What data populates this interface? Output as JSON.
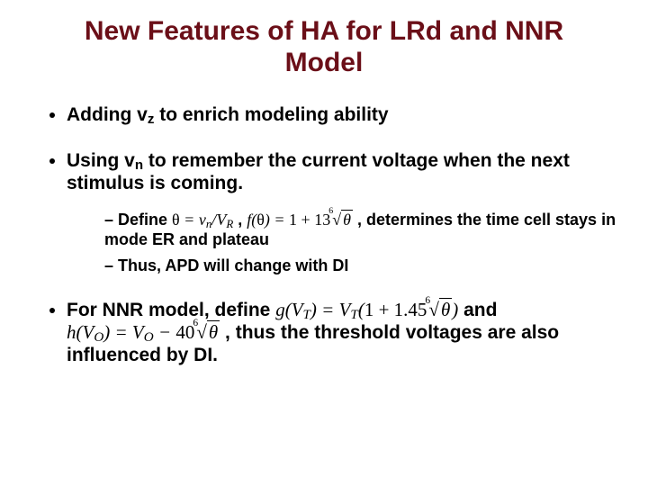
{
  "title": "New Features of HA for LRd and NNR Model",
  "bullets": {
    "b1a": "Adding v",
    "b1sub": "z",
    "b1b": " to enrich modeling ability",
    "b2a": "Using v",
    "b2sub": "n",
    "b2b": " to remember the current voltage when the next stimulus is coming.",
    "b3a": "For NNR model, define ",
    "b3b": " and ",
    "b3c": " , thus the threshold voltages are also influenced by DI."
  },
  "sub": {
    "s1a": "Define ",
    "s1b": " , ",
    "s1c": " , determines the time cell stays in mode ER and plateau",
    "s2": "Thus, APD will change with DI"
  },
  "math": {
    "theta_def": "θ = v_n / V_R",
    "f_def": "f(θ) = 1 + 13 · 6√θ",
    "f_root_deg": "6",
    "g_def": "g(V_T) = V_T (1 + 1.45 · 6√θ)",
    "g_root_deg": "6",
    "h_def": "h(V_O) = V_O − 40 · 6√θ",
    "h_root_deg": "6"
  },
  "chart_data": {
    "type": "table",
    "title": "Slide bullet content",
    "rows": [
      [
        "Adding v_z to enrich modeling ability"
      ],
      [
        "Using v_n to remember the current voltage when the next stimulus is coming."
      ],
      [
        "Define θ = v_n / V_R , f(θ) = 1 + 13·⁶√θ , determines the time cell stays in mode ER and plateau"
      ],
      [
        "Thus, APD will change with DI"
      ],
      [
        "For NNR model, define g(V_T) = V_T(1 + 1.45·⁶√θ) and h(V_O) = V_O − 40·⁶√θ , thus the threshold voltages are also influenced by DI."
      ]
    ]
  }
}
